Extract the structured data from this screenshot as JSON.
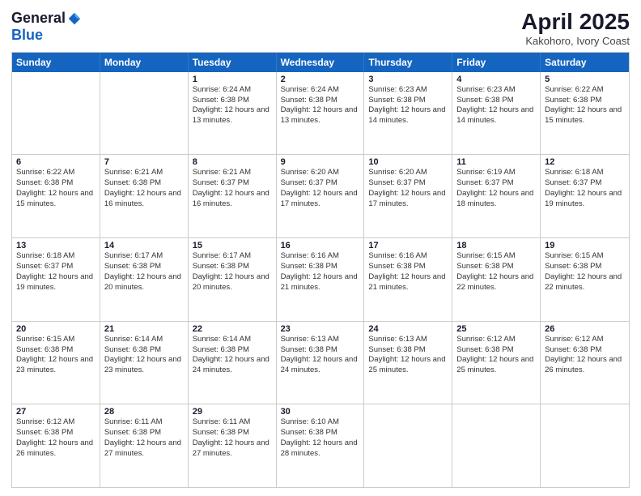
{
  "logo": {
    "general": "General",
    "blue": "Blue"
  },
  "title": "April 2025",
  "location": "Kakohoro, Ivory Coast",
  "header_days": [
    "Sunday",
    "Monday",
    "Tuesday",
    "Wednesday",
    "Thursday",
    "Friday",
    "Saturday"
  ],
  "weeks": [
    [
      {
        "day": "",
        "info": ""
      },
      {
        "day": "",
        "info": ""
      },
      {
        "day": "1",
        "info": "Sunrise: 6:24 AM\nSunset: 6:38 PM\nDaylight: 12 hours and 13 minutes."
      },
      {
        "day": "2",
        "info": "Sunrise: 6:24 AM\nSunset: 6:38 PM\nDaylight: 12 hours and 13 minutes."
      },
      {
        "day": "3",
        "info": "Sunrise: 6:23 AM\nSunset: 6:38 PM\nDaylight: 12 hours and 14 minutes."
      },
      {
        "day": "4",
        "info": "Sunrise: 6:23 AM\nSunset: 6:38 PM\nDaylight: 12 hours and 14 minutes."
      },
      {
        "day": "5",
        "info": "Sunrise: 6:22 AM\nSunset: 6:38 PM\nDaylight: 12 hours and 15 minutes."
      }
    ],
    [
      {
        "day": "6",
        "info": "Sunrise: 6:22 AM\nSunset: 6:38 PM\nDaylight: 12 hours and 15 minutes."
      },
      {
        "day": "7",
        "info": "Sunrise: 6:21 AM\nSunset: 6:38 PM\nDaylight: 12 hours and 16 minutes."
      },
      {
        "day": "8",
        "info": "Sunrise: 6:21 AM\nSunset: 6:37 PM\nDaylight: 12 hours and 16 minutes."
      },
      {
        "day": "9",
        "info": "Sunrise: 6:20 AM\nSunset: 6:37 PM\nDaylight: 12 hours and 17 minutes."
      },
      {
        "day": "10",
        "info": "Sunrise: 6:20 AM\nSunset: 6:37 PM\nDaylight: 12 hours and 17 minutes."
      },
      {
        "day": "11",
        "info": "Sunrise: 6:19 AM\nSunset: 6:37 PM\nDaylight: 12 hours and 18 minutes."
      },
      {
        "day": "12",
        "info": "Sunrise: 6:18 AM\nSunset: 6:37 PM\nDaylight: 12 hours and 19 minutes."
      }
    ],
    [
      {
        "day": "13",
        "info": "Sunrise: 6:18 AM\nSunset: 6:37 PM\nDaylight: 12 hours and 19 minutes."
      },
      {
        "day": "14",
        "info": "Sunrise: 6:17 AM\nSunset: 6:38 PM\nDaylight: 12 hours and 20 minutes."
      },
      {
        "day": "15",
        "info": "Sunrise: 6:17 AM\nSunset: 6:38 PM\nDaylight: 12 hours and 20 minutes."
      },
      {
        "day": "16",
        "info": "Sunrise: 6:16 AM\nSunset: 6:38 PM\nDaylight: 12 hours and 21 minutes."
      },
      {
        "day": "17",
        "info": "Sunrise: 6:16 AM\nSunset: 6:38 PM\nDaylight: 12 hours and 21 minutes."
      },
      {
        "day": "18",
        "info": "Sunrise: 6:15 AM\nSunset: 6:38 PM\nDaylight: 12 hours and 22 minutes."
      },
      {
        "day": "19",
        "info": "Sunrise: 6:15 AM\nSunset: 6:38 PM\nDaylight: 12 hours and 22 minutes."
      }
    ],
    [
      {
        "day": "20",
        "info": "Sunrise: 6:15 AM\nSunset: 6:38 PM\nDaylight: 12 hours and 23 minutes."
      },
      {
        "day": "21",
        "info": "Sunrise: 6:14 AM\nSunset: 6:38 PM\nDaylight: 12 hours and 23 minutes."
      },
      {
        "day": "22",
        "info": "Sunrise: 6:14 AM\nSunset: 6:38 PM\nDaylight: 12 hours and 24 minutes."
      },
      {
        "day": "23",
        "info": "Sunrise: 6:13 AM\nSunset: 6:38 PM\nDaylight: 12 hours and 24 minutes."
      },
      {
        "day": "24",
        "info": "Sunrise: 6:13 AM\nSunset: 6:38 PM\nDaylight: 12 hours and 25 minutes."
      },
      {
        "day": "25",
        "info": "Sunrise: 6:12 AM\nSunset: 6:38 PM\nDaylight: 12 hours and 25 minutes."
      },
      {
        "day": "26",
        "info": "Sunrise: 6:12 AM\nSunset: 6:38 PM\nDaylight: 12 hours and 26 minutes."
      }
    ],
    [
      {
        "day": "27",
        "info": "Sunrise: 6:12 AM\nSunset: 6:38 PM\nDaylight: 12 hours and 26 minutes."
      },
      {
        "day": "28",
        "info": "Sunrise: 6:11 AM\nSunset: 6:38 PM\nDaylight: 12 hours and 27 minutes."
      },
      {
        "day": "29",
        "info": "Sunrise: 6:11 AM\nSunset: 6:38 PM\nDaylight: 12 hours and 27 minutes."
      },
      {
        "day": "30",
        "info": "Sunrise: 6:10 AM\nSunset: 6:38 PM\nDaylight: 12 hours and 28 minutes."
      },
      {
        "day": "",
        "info": ""
      },
      {
        "day": "",
        "info": ""
      },
      {
        "day": "",
        "info": ""
      }
    ]
  ]
}
